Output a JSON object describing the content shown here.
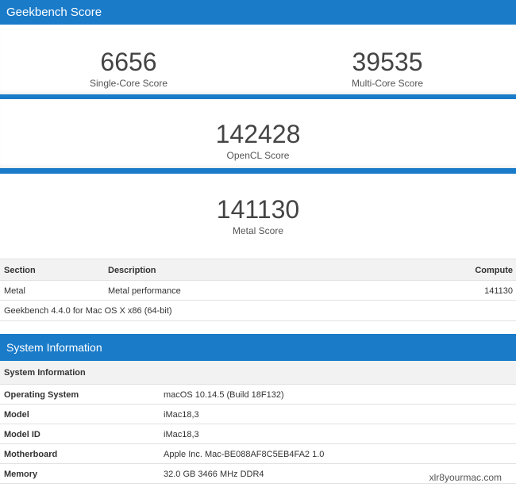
{
  "geekbench_score": {
    "title": "Geekbench Score",
    "single_core": {
      "value": "6656",
      "label": "Single-Core Score"
    },
    "multi_core": {
      "value": "39535",
      "label": "Multi-Core Score"
    },
    "opencl": {
      "value": "142428",
      "label": "OpenCL Score"
    },
    "metal": {
      "value": "141130",
      "label": "Metal Score"
    }
  },
  "compute_table": {
    "headers": {
      "section": "Section",
      "description": "Description",
      "compute": "Compute"
    },
    "rows": [
      {
        "section": "Metal",
        "description": "Metal performance",
        "compute": "141130"
      }
    ],
    "footer": "Geekbench 4.4.0 for Mac OS X x86 (64-bit)"
  },
  "system_information": {
    "title": "System Information",
    "subheader": "System Information",
    "rows": [
      {
        "label": "Operating System",
        "value": "macOS 10.14.5 (Build 18F132)"
      },
      {
        "label": "Model",
        "value": "iMac18,3"
      },
      {
        "label": "Model ID",
        "value": "iMac18,3"
      },
      {
        "label": "Motherboard",
        "value": "Apple Inc. Mac-BE088AF8C5EB4FA2 1.0"
      },
      {
        "label": "Memory",
        "value": "32.0 GB 3466 MHz DDR4"
      }
    ]
  },
  "watermark": "xlr8yourmac.com",
  "colors": {
    "header_blue": "#1a7bc9",
    "table_header_bg": "#f2f2f2"
  }
}
